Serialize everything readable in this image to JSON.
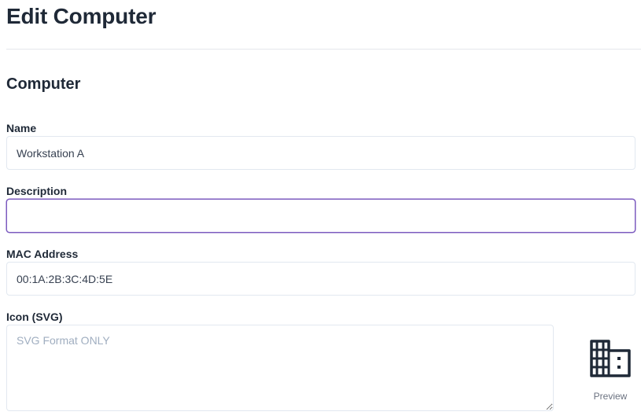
{
  "page": {
    "title": "Edit Computer"
  },
  "section": {
    "title": "Computer"
  },
  "fields": {
    "name": {
      "label": "Name",
      "value": "Workstation A"
    },
    "description": {
      "label": "Description",
      "value": ""
    },
    "mac_address": {
      "label": "MAC Address",
      "value": "00:1A:2B:3C:4D:5E"
    },
    "icon_svg": {
      "label": "Icon (SVG)",
      "placeholder": "SVG Format ONLY",
      "value": ""
    }
  },
  "preview": {
    "label": "Preview",
    "icon": "building-icon"
  },
  "colors": {
    "text": "#1f2937",
    "border": "#e2e8f0",
    "focus_border": "#7c5bbf",
    "placeholder": "#a0aec0"
  }
}
